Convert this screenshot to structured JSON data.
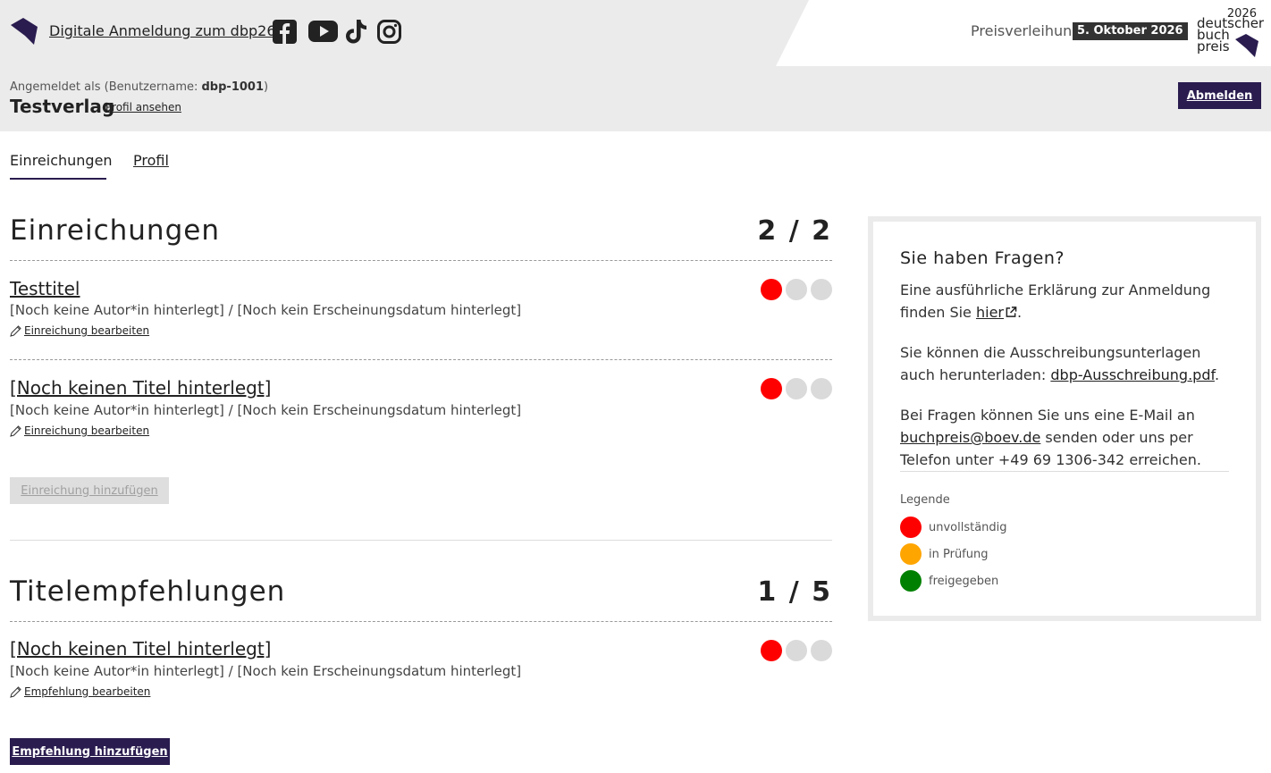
{
  "header": {
    "title": "Digitale Anmeldung zum dbp26",
    "social_icons": [
      "facebook-icon",
      "youtube-icon",
      "tiktok-icon",
      "instagram-icon"
    ],
    "award_label": "Preisverleihung",
    "award_date": "5. Oktober 2026",
    "brand": {
      "year": "2026",
      "line1": "deutscher",
      "line2": "buch",
      "line3": "preis"
    }
  },
  "login": {
    "prefix": "Angemeldet als (Benutzername: ",
    "username": "dbp-1001",
    "suffix": ")",
    "publisher": "Testverlag",
    "profile_link": "Profil ansehen",
    "logout": "Abmelden"
  },
  "tabs": [
    {
      "label": "Einreichungen",
      "active": true
    },
    {
      "label": "Profil",
      "active": false
    }
  ],
  "submissions": {
    "title": "Einreichungen",
    "count": "2 / 2",
    "items": [
      {
        "title": "Testtitel",
        "meta": "[Noch keine Autor*in hinterlegt] / [Noch kein Erscheinungsdatum hinterlegt]",
        "edit": "Einreichung bearbeiten"
      },
      {
        "title": "[Noch keinen Titel hinterlegt]",
        "meta": "[Noch keine Autor*in hinterlegt] / [Noch kein Erscheinungsdatum hinterlegt]",
        "edit": "Einreichung bearbeiten"
      }
    ],
    "add_button": "Einreichung hinzufügen"
  },
  "recommendations": {
    "title": "Titelempfehlungen",
    "count": "1 / 5",
    "items": [
      {
        "title": "[Noch keinen Titel hinterlegt]",
        "meta": "[Noch keine Autor*in hinterlegt] / [Noch kein Erscheinungsdatum hinterlegt]",
        "edit": "Empfehlung bearbeiten"
      }
    ],
    "add_button": "Empfehlung hinzufügen"
  },
  "sidebar": {
    "title": "Sie haben Fragen?",
    "p1_a": "Eine ausführliche Erklärung zur Anmeldung finden Sie ",
    "p1_link": "hier",
    "p1_b": ".",
    "p2_a": "Sie können die Ausschreibungsunterlagen auch herunterladen: ",
    "p2_link": "dbp-Ausschreibung.pdf",
    "p2_b": ".",
    "p3_a": "Bei Fragen können Sie uns eine E-Mail an ",
    "p3_link": "buchpreis@boev.de",
    "p3_b": " senden oder uns per Telefon unter +49 69 1306-342 erreichen.",
    "legend_title": "Legende",
    "legend": [
      {
        "label": "unvollständig",
        "color": "#ff0000"
      },
      {
        "label": "in Prüfung",
        "color": "#ffa500"
      },
      {
        "label": "freigegeben",
        "color": "#008000"
      }
    ]
  },
  "colors": {
    "accent": "#2a1c4f",
    "status_incomplete": "#ff0000",
    "status_empty": "#dadada"
  }
}
